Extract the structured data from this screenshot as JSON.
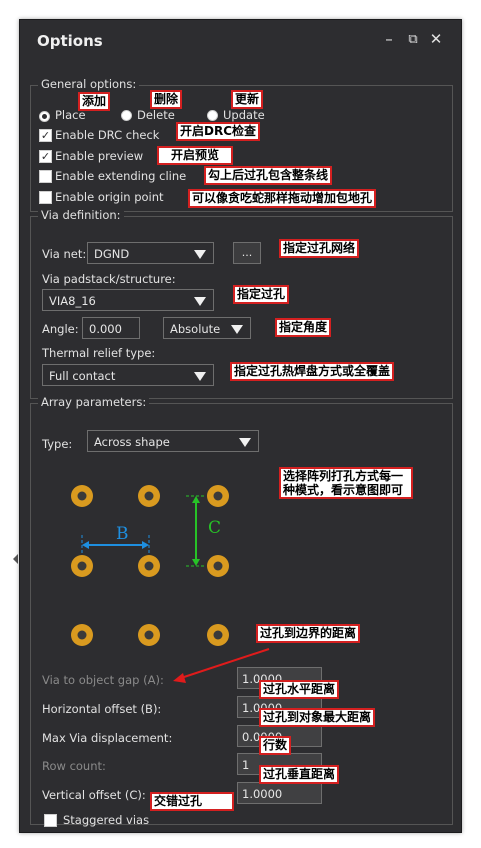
{
  "window": {
    "title": "Options",
    "min_icon": "minimize-icon",
    "restore_icon": "restore-icon",
    "close_icon": "close-icon"
  },
  "general": {
    "legend": "General options:",
    "place": "Place",
    "delete": "Delete",
    "update": "Update",
    "enable_drc": "Enable DRC check",
    "enable_preview": "Enable preview",
    "enable_extending": "Enable extending cline",
    "enable_origin": "Enable origin point"
  },
  "via_def": {
    "legend": "Via definition:",
    "via_net_label": "Via net:",
    "via_net_value": "DGND",
    "browse_label": "...",
    "padstack_label": "Via padstack/structure:",
    "padstack_value": "VIA8_16",
    "angle_label": "Angle:",
    "angle_value": "0.000",
    "angle_mode": "Absolute",
    "thermal_label": "Thermal relief type:",
    "thermal_value": "Full contact"
  },
  "array": {
    "legend": "Array parameters:",
    "type_label": "Type:",
    "type_value": "Across shape",
    "diagram_b": "B",
    "diagram_c": "C",
    "gap_label": "Via to object gap (A):",
    "gap_value": "1.0000",
    "hoff_label": "Horizontal offset (B):",
    "hoff_value": "1.0000",
    "maxdisp_label": "Max Via displacement:",
    "maxdisp_value": "0.0000",
    "rowcount_label": "Row count:",
    "rowcount_value": "1",
    "voff_label": "Vertical offset (C):",
    "voff_value": "1.0000",
    "staggered_label": "Staggered vias"
  },
  "annotations": {
    "add": "添加",
    "delete": "删除",
    "update": "更新",
    "drc": "开启DRC检查",
    "preview": "开启预览",
    "extending": "勾上后过孔包含整条线",
    "origin": "可以像贪吃蛇那样拖动增加包地孔",
    "via_net": "指定过孔网络",
    "padstack": "指定过孔",
    "angle": "指定角度",
    "thermal": "指定过孔热焊盘方式或全覆盖",
    "array_mode": "选择阵列打孔方式每一种模式，看示意图即可",
    "gap": "过孔到边界的距离",
    "hoff": "过孔水平距离",
    "maxdisp": "过孔到对象最大距离",
    "rowcount": "行数",
    "voff": "过孔垂直距离",
    "staggered": "交错过孔"
  },
  "colors": {
    "via_ring": "#d99a1f",
    "dim_b": "#1e8fe0",
    "dim_c": "#27c227",
    "annotation_border": "#d42020",
    "arrow": "#e01b1b"
  }
}
